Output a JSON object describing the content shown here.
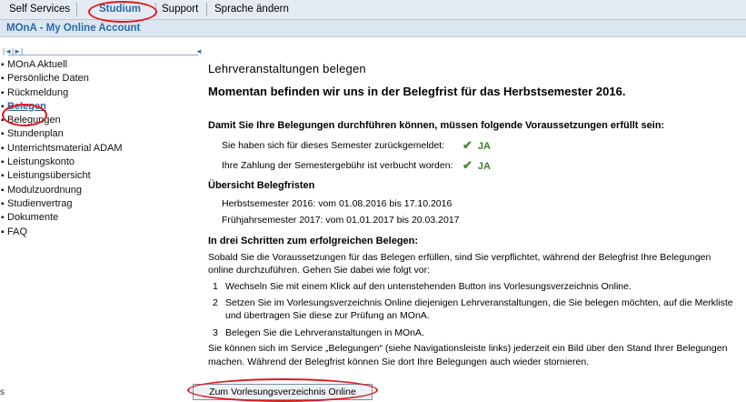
{
  "topnav": {
    "tabs": [
      "Self Services",
      "Studium",
      "Support",
      "Sprache ändern"
    ]
  },
  "titlebar": {
    "title": "MOnA - My Online Account"
  },
  "sidebar": {
    "controls": [
      "|◄|►|",
      "◄"
    ],
    "items": [
      "MOnA Aktuell",
      "Persönliche Daten",
      "Rückmeldung",
      "Belegen",
      "Belegungen",
      "Stundenplan",
      "Unterrichtsmaterial ADAM",
      "Leistungskonto",
      "Leistungsübersicht",
      "Modulzuordnung",
      "Studienvertrag",
      "Dokumente",
      "FAQ"
    ],
    "active_index": 3,
    "footer_mark": "s"
  },
  "main": {
    "page_title": "Lehrveranstaltungen belegen",
    "period_notice": "Momentan befinden wir uns in der Belegfrist für das Herbstsemester 2016.",
    "prereq_heading": "Damit Sie Ihre Belegungen durchführen können, müssen folgende Voraussetzungen erfüllt sein:",
    "prereqs": [
      {
        "text": "Sie haben sich für dieses Semester zurückgemeldet:",
        "status": "JA"
      },
      {
        "text": "Ihre Zahlung der Semestergebühr ist verbucht worden:",
        "status": "JA"
      }
    ],
    "deadlines_heading": "Übersicht Belegfristen",
    "deadlines": [
      "Herbstsemester 2016: vom 01.08.2016 bis 17.10.2016",
      "Frühjahrsemester 2017: vom 01.01.2017 bis 20.03.2017"
    ],
    "steps_heading": "In drei Schritten zum erfolgreichen Belegen:",
    "steps_intro_line1": "Sobald Sie die Voraussetzungen für das Belegen erfüllen, sind Sie verpflichtet, während der Belegfrist Ihre Belegungen",
    "steps_intro_line2": "online durchzuführen. Gehen Sie dabei wie folgt vor:",
    "steps": [
      {
        "num": "1",
        "line1": "Wechseln Sie mit einem Klick auf den untenstehenden Button ins Vorlesungsverzeichnis Online.",
        "line2": ""
      },
      {
        "num": "2",
        "line1": "Setzen Sie im Vorlesungsverzeichnis Online diejenigen Lehrveranstaltungen, die Sie belegen möchten, auf die Merkliste",
        "line2": "und übertragen Sie diese zur Prüfung an MOnA."
      },
      {
        "num": "3",
        "line1": "Belegen Sie die Lehrveranstaltungen in MOnA.",
        "line2": ""
      }
    ],
    "closing_line1": "Sie können sich im Service „Belegungen“ (siehe Navigationsleiste links) jederzeit ein Bild über den Stand Ihrer Belegungen",
    "closing_line2": "machen. Während der Belegfrist können Sie dort Ihre Belegungen auch wieder stornieren.",
    "button_label": "Zum Vorlesungsverzeichnis Online"
  },
  "icons": {
    "check": "check-icon",
    "bullet": "bullet-icon"
  },
  "colors": {
    "highlight_ring": "#e0181e",
    "title_blue": "#2a6aa7",
    "ok_green": "#3e7a2f"
  }
}
